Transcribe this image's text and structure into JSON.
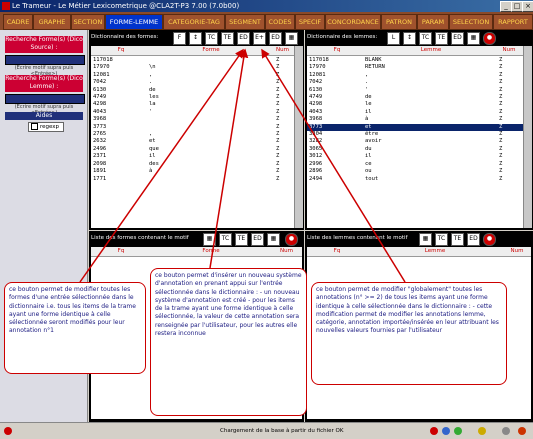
{
  "window": {
    "title": "Le Trameur - Le Métier Lexicometrique @CLA2T-P3 7.00 (7.0b00)"
  },
  "tabs": [
    "CADRE",
    "GRAPHE",
    "SECTION",
    "FORME-LEMME",
    "CATEGORIE-TAG",
    "SEGMENT",
    "CODES",
    "SPECIF",
    "CONCORDANCE",
    "PATRON",
    "PARAM",
    "SELECTION",
    "RAPPORT"
  ],
  "active_tab": "FORME-LEMME",
  "left": {
    "search_forme": "Recherche Forme(s) (Dico Source) :",
    "hint1": "(Ecrire motif supra puis <Entrée>)",
    "search_lemme": "Recherche Forme(s) (Dico Lemme) :",
    "hint2": "(Ecrire motif supra puis <Entrée>)",
    "aides": "Aides",
    "regexp": "regexp"
  },
  "dict_formes": {
    "title": "Dictionnaire des formes:",
    "headers": [
      "Fq",
      "Forme",
      "Num"
    ],
    "fq": [
      "117018",
      "17970",
      "12081",
      "7042",
      "6130",
      "4749",
      "4298",
      "4043",
      "3968",
      "3773",
      "2765",
      "2632",
      "2496",
      "2371",
      "2098",
      "1891",
      "1771"
    ],
    "forme": [
      "",
      "\\n",
      ",",
      ".",
      "de",
      "les",
      "la",
      "'",
      "",
      "",
      ",",
      "et",
      "que",
      "il",
      "des",
      "à",
      ""
    ],
    "num": [
      "Z",
      "Z",
      "Z",
      "Z",
      "Z",
      "Z",
      "Z",
      "Z",
      "Z",
      "Z",
      "Z",
      "Z",
      "Z",
      "Z",
      "Z",
      "Z",
      "Z"
    ]
  },
  "dict_lemmes": {
    "title": "Dictionnaire des lemmes:",
    "headers": [
      "Fq",
      "Lemme",
      "Num"
    ],
    "fq": [
      "117018",
      "17970",
      "12081",
      "7042",
      "6130",
      "4749",
      "4298",
      "4043",
      "3968",
      "3773",
      "3304",
      "3282",
      "3065",
      "3012",
      "2996",
      "2896",
      "2494"
    ],
    "lemme": [
      "BLANK",
      "RETURN",
      ",",
      ".",
      "'",
      "de",
      "le",
      "il",
      "à",
      "et",
      "être",
      "avoir",
      "du",
      "il",
      "ce",
      "ou",
      "tout"
    ],
    "num": [
      "Z",
      "Z",
      "Z",
      "Z",
      "Z",
      "Z",
      "Z",
      "Z",
      "Z",
      "Z",
      "Z",
      "Z",
      "Z",
      "Z",
      "Z",
      "Z",
      "Z"
    ],
    "selected_index": 9
  },
  "list_formes": {
    "title": "Liste des formes contenant le motif",
    "headers": [
      "Fq",
      "Forme",
      "Num"
    ]
  },
  "list_lemmes": {
    "title": "Liste des lemmes contenant le motif",
    "headers": [
      "Fq",
      "Lemme",
      "Num"
    ]
  },
  "notes": {
    "n1": "ce bouton permet de modifier toutes les formes d'une entrée sélectionnée dans le dictionnaire i.e. tous les items de la trame ayant une forme identique à celle sélectionnée seront modifiés pour leur annotation n°1",
    "n2": "ce bouton permet d'insérer un nouveau système d'annotation en prenant appui sur l'entrée sélectionnée dans le dictionnaire : - un nouveau système d'annotation est créé - pour les items de la trame ayant une forme identique à celle sélectionnée, la valeur de cette annotation sera renseignée par l'utilisateur, pour les autres elle restera inconnue",
    "n3": "ce bouton permet de modifier \"globalement\" toutes les annotations (n° >= 2) de tous les items ayant une forme identique à celle sélectionnée dans le dictionnaire : - cette modification permet de modifier les annotations lemme, catégorie, annotation importée/insérée en leur attribuant les nouvelles valeurs fournies par l'utilisateur"
  },
  "status": "Chargement de la base à partir du fichier OK",
  "icons": [
    "forme-icon",
    "tc-icon",
    "ed-icon",
    "ed-global-icon",
    "stop-icon"
  ],
  "colors": {
    "tabs": "#a0522d",
    "active_tab": "#0033cc",
    "arrow": "#cc0000"
  }
}
